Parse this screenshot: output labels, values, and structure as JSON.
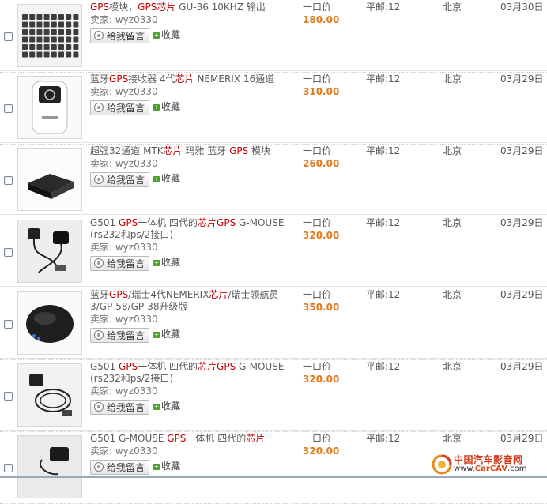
{
  "common": {
    "seller_label": "卖家: wyz0330",
    "message_button": "给我留言",
    "favorite": "收藏",
    "price_type": "一口价",
    "shipping": "平邮:12",
    "city": "北京"
  },
  "items": [
    {
      "title_parts": [
        {
          "t": "GPS",
          "kw": true
        },
        {
          "t": "模块，",
          "kw": false
        },
        {
          "t": "GPS",
          "kw": true
        },
        {
          "t": "芯片",
          "kw": true
        },
        {
          "t": " GU-36 10KHZ 输出",
          "kw": false
        }
      ],
      "price": "180.00",
      "date": "03月30日"
    },
    {
      "title_parts": [
        {
          "t": "蓝牙",
          "kw": false
        },
        {
          "t": "GPS",
          "kw": true
        },
        {
          "t": "接收器 4代",
          "kw": false
        },
        {
          "t": "芯片",
          "kw": true
        },
        {
          "t": " NEMERIX 16通道",
          "kw": false
        }
      ],
      "price": "310.00",
      "date": "03月29日"
    },
    {
      "title_parts": [
        {
          "t": "超强32通道 MTK",
          "kw": false
        },
        {
          "t": "芯片",
          "kw": true
        },
        {
          "t": " 玛雅 蓝牙 ",
          "kw": false
        },
        {
          "t": "GPS",
          "kw": true
        },
        {
          "t": " 模块",
          "kw": false
        }
      ],
      "price": "260.00",
      "date": "03月29日"
    },
    {
      "title_parts": [
        {
          "t": "G501 ",
          "kw": false
        },
        {
          "t": "GPS",
          "kw": true
        },
        {
          "t": "一体机 四代的",
          "kw": false
        },
        {
          "t": "芯片",
          "kw": true
        },
        {
          "t": "GPS",
          "kw": true
        },
        {
          "t": " G-MOUSE (rs232和ps/2接口)",
          "kw": false
        }
      ],
      "price": "320.00",
      "date": "03月29日"
    },
    {
      "title_parts": [
        {
          "t": "蓝牙",
          "kw": false
        },
        {
          "t": "GPS",
          "kw": true
        },
        {
          "t": "/瑞士4代NEMERIX",
          "kw": false
        },
        {
          "t": "芯片",
          "kw": true
        },
        {
          "t": "/瑞士领航员3/GP-58/GP-38升级版",
          "kw": false
        }
      ],
      "price": "350.00",
      "date": "03月29日"
    },
    {
      "title_parts": [
        {
          "t": "G501 ",
          "kw": false
        },
        {
          "t": "GPS",
          "kw": true
        },
        {
          "t": "一体机 四代的",
          "kw": false
        },
        {
          "t": "芯片",
          "kw": true
        },
        {
          "t": "GPS",
          "kw": true
        },
        {
          "t": " G-MOUSE (rs232和ps/2接口)",
          "kw": false
        }
      ],
      "price": "320.00",
      "date": "03月29日"
    },
    {
      "title_parts": [
        {
          "t": "G501 G-MOUSE ",
          "kw": false
        },
        {
          "t": "GPS",
          "kw": true
        },
        {
          "t": "一体机 四代的",
          "kw": false
        },
        {
          "t": "芯片",
          "kw": true
        }
      ],
      "price": "320.00",
      "date": "03月29日"
    }
  ],
  "watermark": {
    "line1": "中国汽车影音网",
    "line2_prefix": "www.",
    "line2_brand": "CarCAV",
    "line2_suffix": ".com"
  },
  "colors": {
    "keyword": "#c00000",
    "price": "#e07a1f",
    "favorite_plus": "#4aa02c"
  }
}
